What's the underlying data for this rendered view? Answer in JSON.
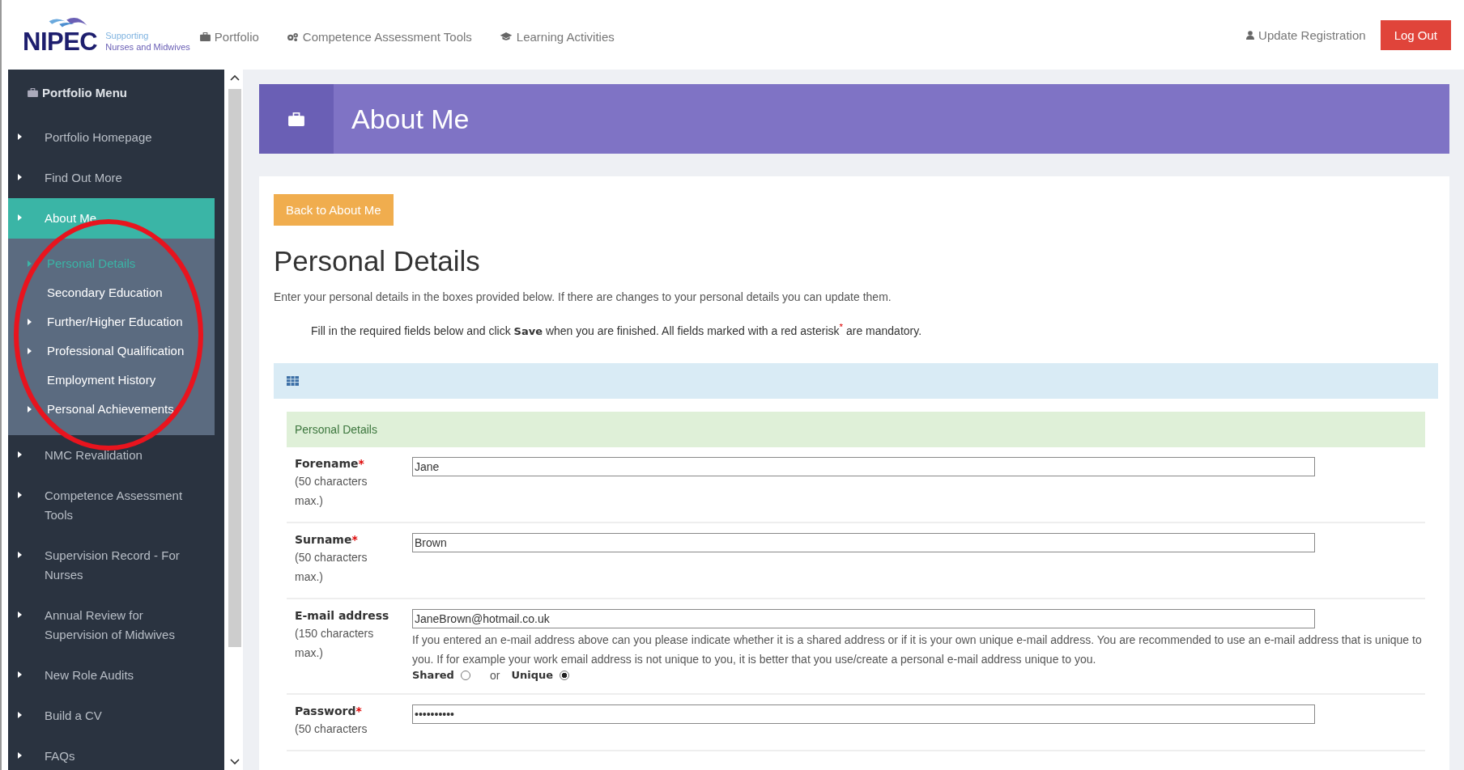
{
  "logo": {
    "name": "NIPEC",
    "tagline_1": "Supporting",
    "tagline_2": "Nurses and Midwives"
  },
  "nav": [
    {
      "label": "Portfolio"
    },
    {
      "label": "Competence Assessment Tools"
    },
    {
      "label": "Learning Activities"
    }
  ],
  "account": [
    {
      "label": "Update Registration",
      "kind": "link"
    },
    {
      "label": "Log Out",
      "kind": "button"
    }
  ],
  "sidebar": {
    "title": "Portfolio Menu",
    "items": [
      {
        "label": "Portfolio Homepage",
        "selected": false
      },
      {
        "label": "Find Out More",
        "selected": false
      },
      {
        "label": "About Me",
        "selected": true,
        "children": [
          {
            "label": "Personal Details",
            "selected": true,
            "arrow": true
          },
          {
            "label": "Secondary Education",
            "selected": false,
            "arrow": false
          },
          {
            "label": "Further/Higher Education",
            "selected": false,
            "arrow": true
          },
          {
            "label": "Professional Qualification",
            "selected": false,
            "arrow": true
          },
          {
            "label": "Employment History",
            "selected": false,
            "arrow": false
          },
          {
            "label": "Personal Achievements",
            "selected": false,
            "arrow": true
          }
        ]
      },
      {
        "label": "NMC Revalidation",
        "selected": false
      },
      {
        "label": "Competence Assessment Tools",
        "selected": false
      },
      {
        "label": "Supervision Record - For Nurses",
        "selected": false
      },
      {
        "label": "Annual Review for Supervision of Midwives",
        "selected": false
      },
      {
        "label": "New Role Audits",
        "selected": false
      },
      {
        "label": "Build a CV",
        "selected": false
      },
      {
        "label": "FAQs",
        "selected": false
      }
    ]
  },
  "annotation": {
    "kind": "ellipse",
    "color": "#e8141e"
  },
  "page_header": {
    "title": "About Me"
  },
  "back_button": "Back to About Me",
  "heading": "Personal Details",
  "intro": "Enter your personal details in the boxes provided below. If there are changes to your personal details you can update them.",
  "instructions": "Fill in the required fields below and click **Save** when you are finished. All fields marked with a red asterisk$^{*}$ are mandatory.",
  "section_title": "Personal Details",
  "fields": [
    {
      "label": "Forename",
      "required_mark": "*",
      "hint": "(50 characters max.)",
      "value": "Jane"
    },
    {
      "label": "Surname",
      "required_mark": "*",
      "hint": "(50 characters max.)",
      "value": "Brown"
    },
    {
      "label": "E-mail address",
      "hint": "(150 characters max.)",
      "value": "JaneBrown@hotmail.co.uk",
      "note": "If you entered an e-mail address above can you please indicate whether it is a shared address or if it is your own unique e-mail address. You are recommended to use an e-mail address that is unique to you. If for example your work email address is not unique to you, it is better that you use/create a personal e-mail address unique to you.",
      "options": [
        {
          "label": "Shared",
          "selected": false
        },
        {
          "label": "Unique",
          "selected": true
        }
      ],
      "separator": "or"
    },
    {
      "label": "Password",
      "required_mark": "*",
      "hint": "(50 characters",
      "value": "••••••••••"
    }
  ]
}
